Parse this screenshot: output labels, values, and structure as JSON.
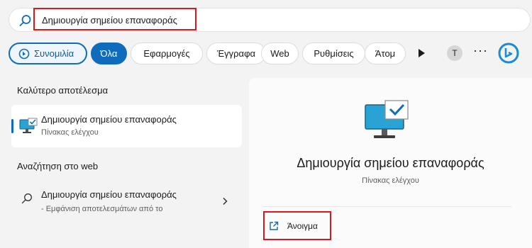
{
  "search": {
    "value": "Δημιουργία σημείου επαναφοράς",
    "placeholder": ""
  },
  "filters": {
    "chat_label": "Συνομιλία",
    "tabs": [
      "Όλα",
      "Εφαρμογές",
      "Έγγραφα",
      "Web",
      "Ρυθμίσεις",
      "Άτομ"
    ],
    "active_tab": "Όλα",
    "avatar_initial": "T",
    "more_label": "···"
  },
  "best_match": {
    "heading": "Καλύτερο αποτέλεσμα",
    "title": "Δημιουργία σημείου επαναφοράς",
    "subtitle": "Πίνακας ελέγχου"
  },
  "web": {
    "heading": "Αναζήτηση στο web",
    "title": "Δημιουργία σημείου επαναφοράς",
    "subtitle": "- Εμφάνιση αποτελεσμάτων από το"
  },
  "detail": {
    "title": "Δημιουργία σημείου επαναφοράς",
    "subtitle": "Πίνακας ελέγχου",
    "open_label": "Άνοιγμα"
  },
  "colors": {
    "accent": "#0f6cbd",
    "highlight": "#e3131b",
    "monitor": "#29a3d6"
  },
  "icons": [
    "search-icon",
    "bing-chat-icon",
    "chevron-right-icon",
    "more-icon",
    "bing-icon",
    "monitor-check-icon",
    "open-external-icon"
  ]
}
